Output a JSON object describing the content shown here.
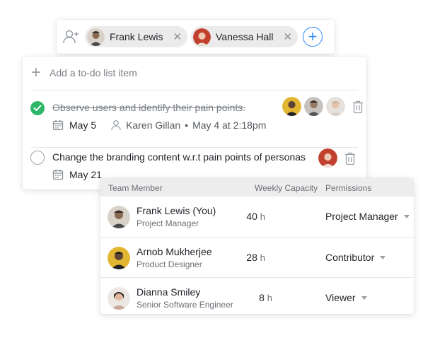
{
  "assignees": {
    "chips": [
      {
        "name": "Frank Lewis",
        "avatar_color": "#d9d2c8"
      },
      {
        "name": "Vanessa Hall",
        "avatar_color": "#c2412e"
      }
    ],
    "remove_glyph": "✕",
    "add_glyph": "+"
  },
  "todo": {
    "add_placeholder": "Add a to-do list item",
    "tasks": [
      {
        "title": "Observe users and identify their pain points.",
        "completed": true,
        "due_date": "May 5",
        "assignee": "Karen Gillan",
        "timestamp": "May 4 at 2:18pm",
        "separator": "•",
        "avatars": [
          "#e2b630",
          "#c7c2bd",
          "#e6e1dc"
        ]
      },
      {
        "title": "Change the branding content w.r.t pain points of personas",
        "completed": false,
        "due_date": "May 21",
        "avatars": [
          "#c2412e"
        ]
      }
    ]
  },
  "team": {
    "headers": {
      "member": "Team Member",
      "capacity": "Weekly Capacity",
      "permissions": "Permissions"
    },
    "rows": [
      {
        "name": "Frank Lewis (You)",
        "role": "Project Manager",
        "capacity": "40",
        "unit": "h",
        "permission": "Project Manager",
        "avatar_color": "#d9d2c8"
      },
      {
        "name": "Arnob Mukherjee",
        "role": "Product Designer",
        "capacity": "28",
        "unit": "h",
        "permission": "Contributor",
        "avatar_color": "#e2b630"
      },
      {
        "name": "Dianna Smiley",
        "role": "Senior Software Engineer",
        "capacity": "8",
        "unit": "h",
        "permission": "Viewer",
        "avatar_color": "#ece7e2"
      }
    ]
  },
  "colors": {
    "accent": "#2f8cf0",
    "success": "#2eb768"
  }
}
